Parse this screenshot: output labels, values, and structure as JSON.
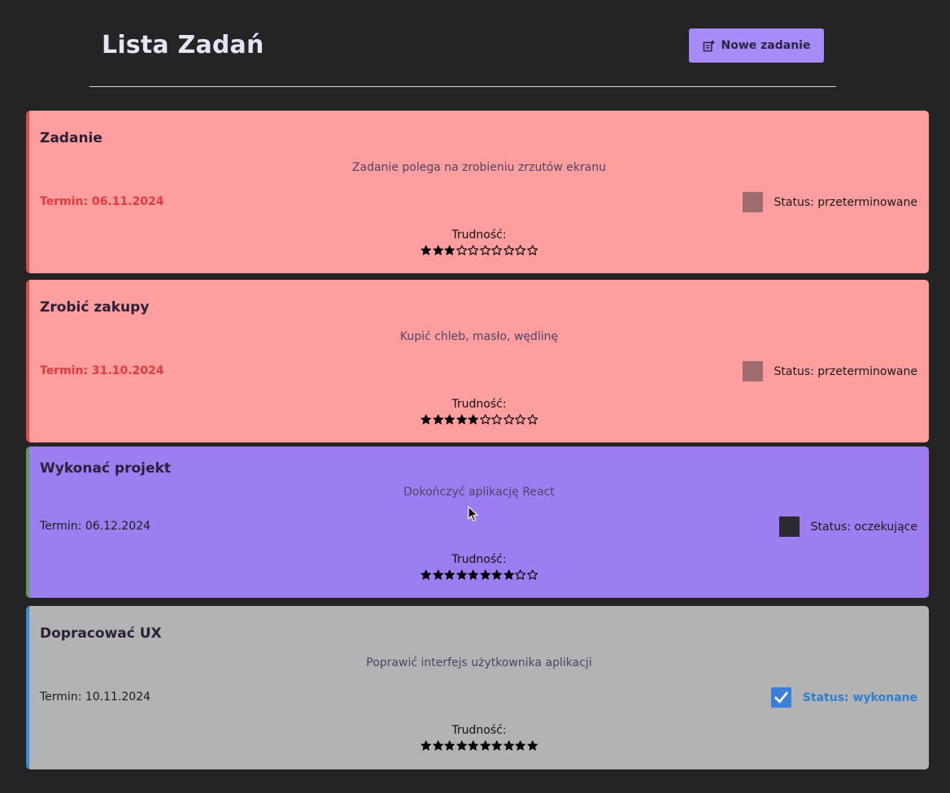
{
  "header": {
    "title": "Lista Zadań",
    "new_task_label": "Nowe zadanie"
  },
  "tasks": [
    {
      "title": "Zadanie",
      "description": "Zadanie polega na zrobieniu zrzutów ekranu",
      "term": "Termin: 06.11.2024",
      "status": "Status: przeterminowane",
      "state": "overdue",
      "difficulty_label": "Trudność:",
      "difficulty": 3,
      "difficulty_max": 10
    },
    {
      "title": "Zrobić zakupy",
      "description": "Kupić chleb, masło, wędlinę",
      "term": "Termin: 31.10.2024",
      "status": "Status: przeterminowane",
      "state": "overdue",
      "difficulty_label": "Trudność:",
      "difficulty": 5,
      "difficulty_max": 10
    },
    {
      "title": "Wykonać projekt",
      "description": "Dokończyć aplikację React",
      "term": "Termin: 06.12.2024",
      "status": "Status: oczekujące",
      "state": "pending",
      "difficulty_label": "Trudność:",
      "difficulty": 8,
      "difficulty_max": 10
    },
    {
      "title": "Dopracować UX",
      "description": "Poprawić interfejs użytkownika aplikacji",
      "term": "Termin: 10.11.2024",
      "status": "Status: wykonane",
      "state": "done",
      "difficulty_label": "Trudność:",
      "difficulty": 10,
      "difficulty_max": 10
    }
  ],
  "colors": {
    "background": "#242424",
    "accent": "#a68cf8",
    "overdue": "#ff9e9e",
    "pending": "#9b7ff0",
    "done": "#b3b3b3"
  },
  "icons": {
    "new_task": "note-add-icon",
    "star_filled": "star-filled-icon",
    "star_empty": "star-outline-icon",
    "checkbox_checked": "checkmark-icon"
  }
}
